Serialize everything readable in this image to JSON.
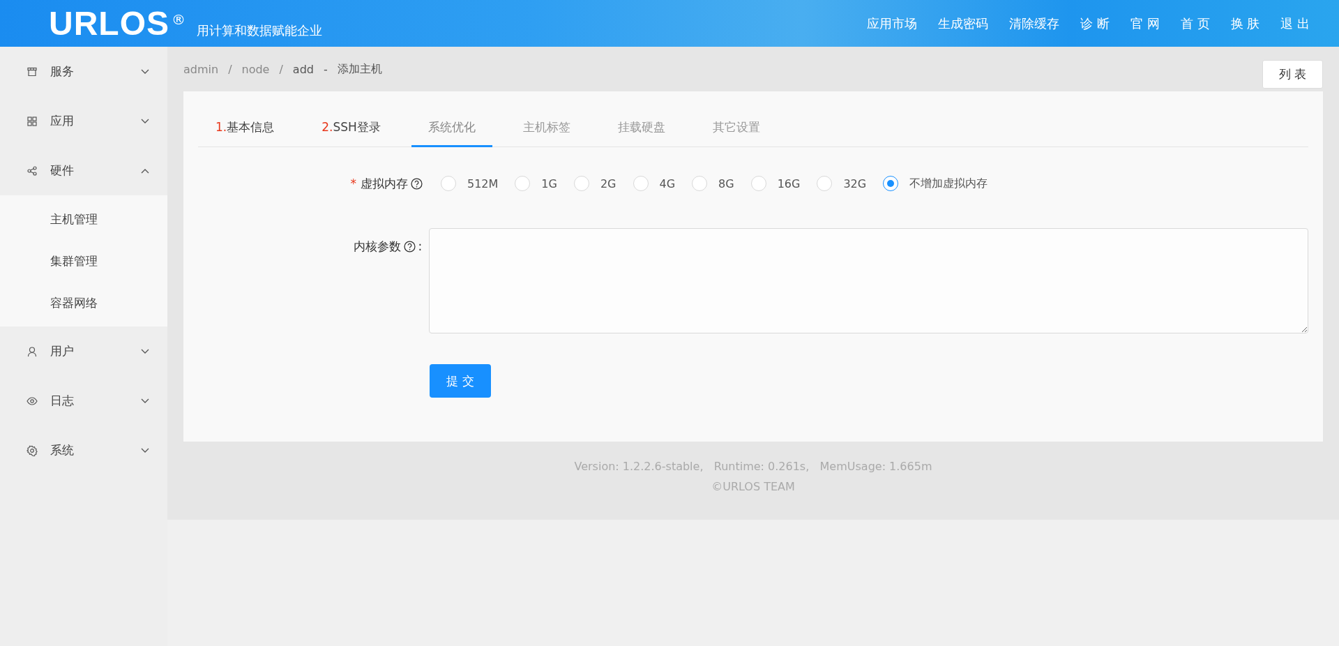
{
  "header": {
    "logo": "URLOS",
    "logo_mark": "®",
    "tagline": "用计算和数据赋能企业",
    "nav": [
      "应用市场",
      "生成密码",
      "清除缓存",
      "诊 断",
      "官 网",
      "首 页",
      "换 肤",
      "退 出"
    ]
  },
  "sidebar": {
    "items": [
      {
        "label": "服务",
        "expanded": false
      },
      {
        "label": "应用",
        "expanded": false
      },
      {
        "label": "硬件",
        "expanded": true,
        "children": [
          {
            "label": "主机管理"
          },
          {
            "label": "集群管理"
          },
          {
            "label": "容器网络"
          }
        ]
      },
      {
        "label": "用户",
        "expanded": false
      },
      {
        "label": "日志",
        "expanded": false
      },
      {
        "label": "系统",
        "expanded": false
      }
    ]
  },
  "breadcrumb": [
    {
      "label": "admin"
    },
    {
      "separator": "/",
      "label": "node"
    },
    {
      "separator": "/",
      "label": "add"
    }
  ],
  "title_separator": "-",
  "page_title": "添加主机",
  "list_button": "列 表",
  "tabs": [
    {
      "step": "1.",
      "label": "基本信息",
      "selected": false
    },
    {
      "step": "2.",
      "label": "SSH登录",
      "selected": false
    },
    {
      "label": "系统优化",
      "selected": true
    },
    {
      "label": "主机标签",
      "selected": false
    },
    {
      "label": "挂载硬盘",
      "selected": false
    },
    {
      "label": "其它设置",
      "selected": false
    }
  ],
  "fields": [
    {
      "kind": "radio",
      "label": "虚拟内存",
      "required_mark": "*",
      "options": [
        {
          "label": "512M",
          "selected": false
        },
        {
          "label": "1G",
          "selected": false
        },
        {
          "label": "2G",
          "selected": false
        },
        {
          "label": "4G",
          "selected": false
        },
        {
          "label": "8G",
          "selected": false
        },
        {
          "label": "16G",
          "selected": false
        },
        {
          "label": "32G",
          "selected": false
        },
        {
          "label": "不增加虚拟内存",
          "selected": true
        }
      ]
    },
    {
      "kind": "textarea",
      "label": "内核参数",
      "suffix": ":"
    }
  ],
  "submit_button": "提 交",
  "footer": {
    "stats": "Version: 1.2.2.6-stable,   Runtime: 0.261s,   MemUsage: 1.665m",
    "copyright": "©URLOS TEAM"
  }
}
